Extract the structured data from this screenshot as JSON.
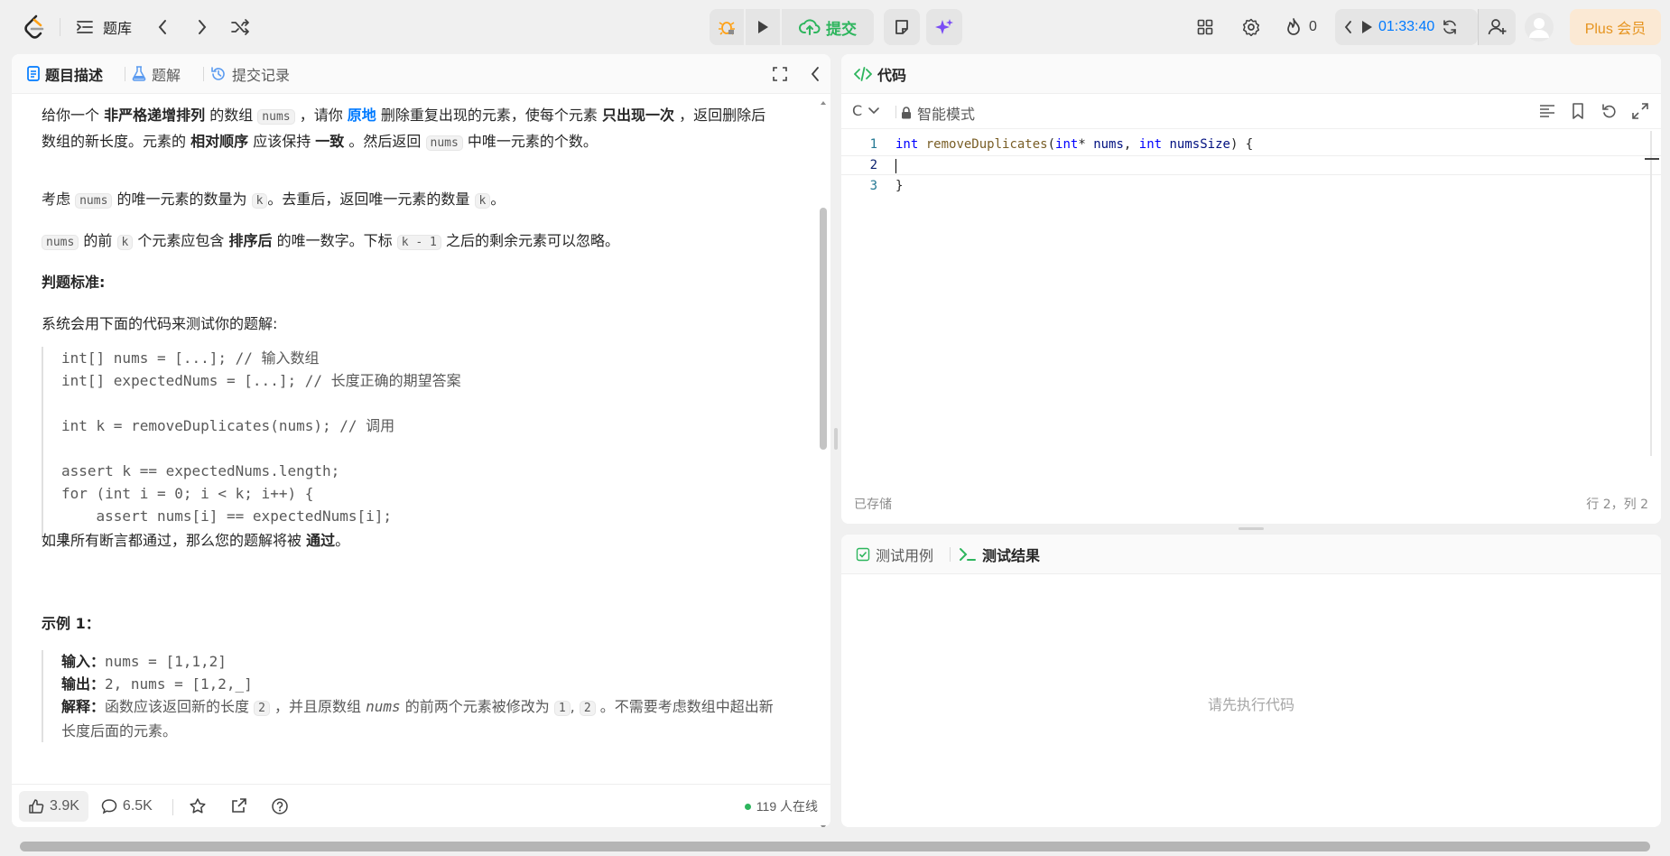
{
  "topbar": {
    "library_label": "题库",
    "submit_label": "提交",
    "streak_count": "0",
    "timer": "01:33:40",
    "plus_label": "Plus 会员"
  },
  "left_panel": {
    "tabs": [
      {
        "label": "题目描述",
        "icon": "document-icon",
        "active": true
      },
      {
        "label": "题解",
        "icon": "flask-icon",
        "active": false
      },
      {
        "label": "提交记录",
        "icon": "history-icon",
        "active": false
      }
    ],
    "description": {
      "p1": {
        "a": "给你一个 ",
        "b": "非严格递增排列",
        "c": " 的数组 ",
        "d": "nums",
        "e": " ，请你 ",
        "f": "原地",
        "g": " 删除重复出现的元素，使每个元素 ",
        "h": "只出现一次",
        "i": " ，返回删除后数组的新长度。元素的 ",
        "j": "相对顺序",
        "k": " 应该保持 ",
        "l": "一致",
        "m": " 。然后返回 ",
        "n": "nums",
        "o": " 中唯一元素的个数。"
      },
      "p2": {
        "a": "考虑 ",
        "b": "nums",
        "c": " 的唯一元素的数量为 ",
        "d": "k",
        "e": "。去重后，返回唯一元素的数量 ",
        "f": "k",
        "g": "。"
      },
      "p3": {
        "a": "nums",
        "b": " 的前 ",
        "c": "k",
        "d": " 个元素应包含 ",
        "e": "排序后",
        "f": " 的唯一数字。下标 ",
        "g": "k - 1",
        "h": " 之后的剩余元素可以忽略。"
      },
      "judge_title": "判题标准:",
      "judge_text": "系统会用下面的代码来测试你的题解:",
      "code_lines": [
        "int[] nums = [...]; // 输入数组",
        "int[] expectedNums = [...]; // 长度正确的期望答案",
        "",
        "int k = removeDuplicates(nums); // 调用",
        "",
        "assert k == expectedNums.length;",
        "for (int i = 0; i < k; i++) {",
        "    assert nums[i] == expectedNums[i];",
        "}"
      ],
      "pass_text_a": "如果所有断言都通过，那么您的题解将被 ",
      "pass_text_b": "通过",
      "pass_text_c": "。",
      "example_title": "示例 1：",
      "example": {
        "input_label": "输入：",
        "input_value": "nums = [1,1,2]",
        "output_label": "输出：",
        "output_value": "2, nums = [1,2,_]",
        "explain_label": "解释：",
        "explain_a": "函数应该返回新的长度 ",
        "explain_b": "2",
        "explain_c": " ，并且原数组 ",
        "explain_d": "nums",
        "explain_e": " 的前两个元素被修改为 ",
        "explain_f": "1",
        "explain_g": ", ",
        "explain_h": "2",
        "explain_i": " 。不需要考虑数组中超出新长度后面的元素。"
      }
    },
    "footer": {
      "likes": "3.9K",
      "comments": "6.5K",
      "online": "119 人在线"
    }
  },
  "code_panel": {
    "title": "代码",
    "language": "C",
    "mode": "智能模式",
    "code": [
      {
        "line": "1",
        "content": "int removeDuplicates(int* nums, int numsSize) {"
      },
      {
        "line": "2",
        "content": ""
      },
      {
        "line": "3",
        "content": "}"
      }
    ],
    "saved": "已存储",
    "cursor_pos": "行 2，列 2"
  },
  "test_panel": {
    "tabs": [
      {
        "label": "测试用例",
        "icon": "checkbox-icon"
      },
      {
        "label": "测试结果",
        "icon": "terminal-icon"
      }
    ],
    "placeholder": "请先执行代码"
  },
  "colors": {
    "accent_green": "#2db55d",
    "accent_blue": "#007aff",
    "plus_orange": "#e6941f"
  }
}
